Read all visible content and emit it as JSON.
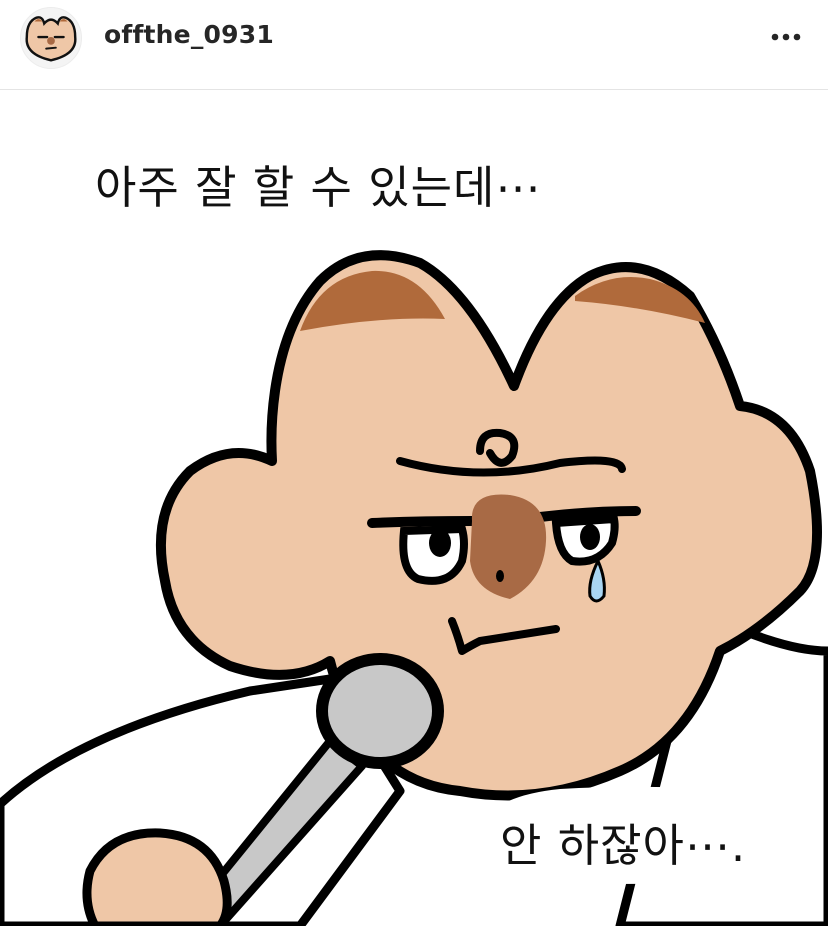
{
  "post": {
    "username": "offthe_0931",
    "more_icon": "more-horizontal-icon",
    "avatar_icon": "character-avatar-icon"
  },
  "comic": {
    "top_caption": "아주 잘 할 수 있는데⋯",
    "bottom_caption": "안 하잖아⋯.",
    "colors": {
      "skin": "#efc7a7",
      "ear": "#b06a3b",
      "nose": "#a86a45",
      "outline": "#000000",
      "microphone": "#c8c8c8",
      "tear": "#a9d5f2"
    }
  }
}
